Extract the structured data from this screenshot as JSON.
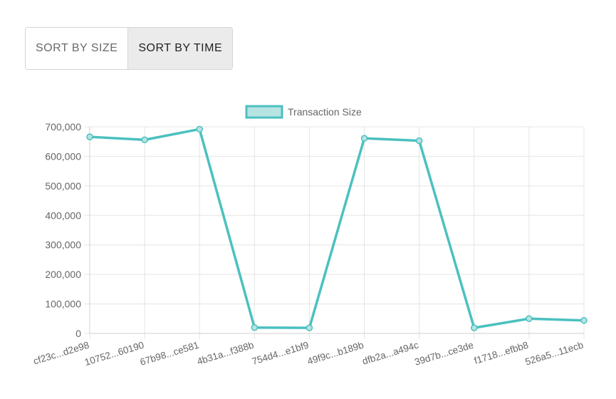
{
  "controls": {
    "sort_size_label": "SORT BY SIZE",
    "sort_time_label": "SORT BY TIME",
    "active": "SORT BY TIME"
  },
  "chart_data": {
    "type": "line",
    "categories": [
      "cf23c...d2e98",
      "10752...60190",
      "67b98...ce581",
      "4b31a...f388b",
      "754d4...e1bf9",
      "49f9c...b189b",
      "dfb2a...a494c",
      "39d7b...ce3de",
      "f1718...efbb8",
      "526a5...11ecb"
    ],
    "series": [
      {
        "name": "Transaction Size",
        "values": [
          666000,
          656000,
          692000,
          20000,
          19000,
          661000,
          653000,
          19000,
          50000,
          44000
        ]
      }
    ],
    "ylim": [
      0,
      700000
    ],
    "yticks": [
      "0",
      "100,000",
      "200,000",
      "300,000",
      "400,000",
      "500,000",
      "600,000",
      "700,000"
    ],
    "grid": true,
    "legend": "top-center",
    "colors": {
      "line": "#4bc0c0",
      "fill": "#b8e3e3",
      "grid": "#e5e5e5",
      "text": "#666666"
    }
  }
}
